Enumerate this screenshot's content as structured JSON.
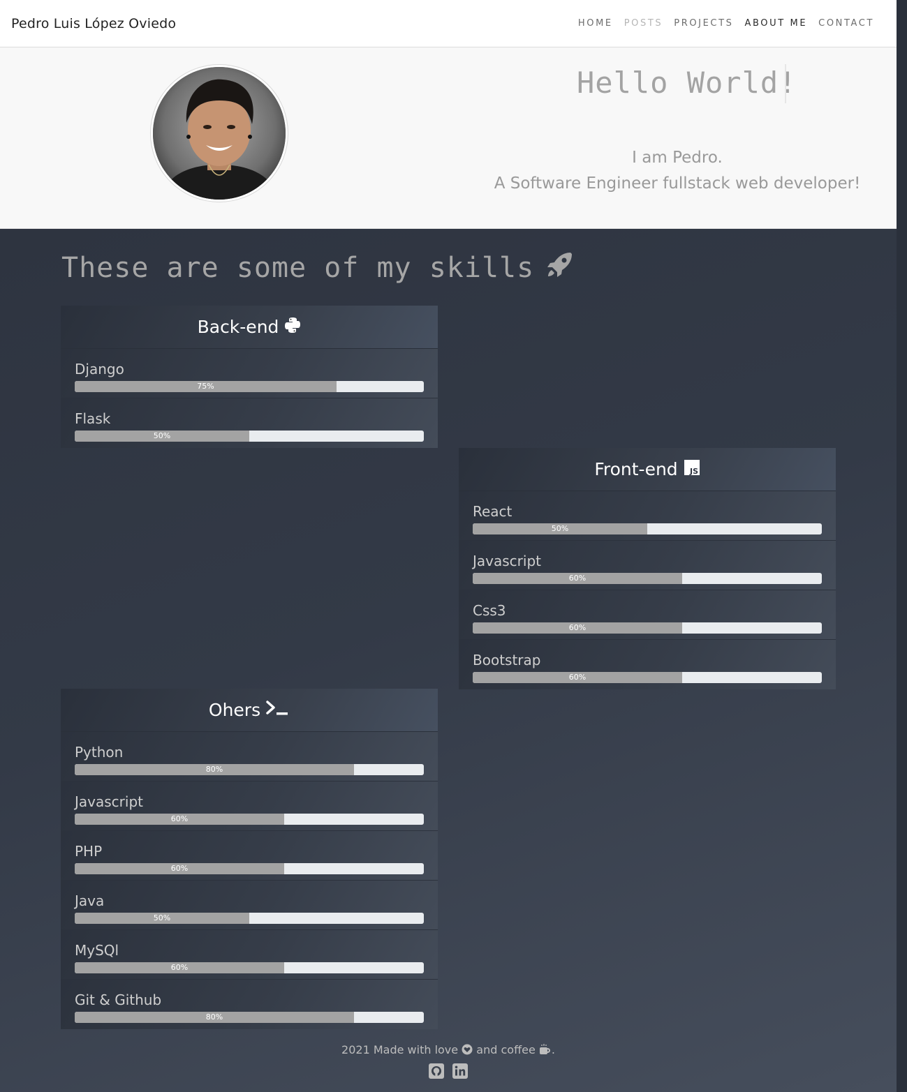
{
  "navbar": {
    "brand": "Pedro Luis López Oviedo",
    "items": [
      {
        "label": "HOME"
      },
      {
        "label": "POSTS"
      },
      {
        "label": "PROJECTS"
      },
      {
        "label": "ABOUT ME"
      },
      {
        "label": "CONTACT"
      }
    ]
  },
  "hero": {
    "title": "Hello World!",
    "line1": "I am Pedro.",
    "line2": "A Software Engineer fullstack web developer!"
  },
  "skills": {
    "title": "These are some of my skills",
    "backend": {
      "title": "Back-end",
      "items": [
        {
          "name": "Django",
          "percent": 75,
          "label": "75%"
        },
        {
          "name": "Flask",
          "percent": 50,
          "label": "50%"
        }
      ]
    },
    "frontend": {
      "title": "Front-end",
      "items": [
        {
          "name": "React",
          "percent": 50,
          "label": "50%"
        },
        {
          "name": "Javascript",
          "percent": 60,
          "label": "60%"
        },
        {
          "name": "Css3",
          "percent": 60,
          "label": "60%"
        },
        {
          "name": "Bootstrap",
          "percent": 60,
          "label": "60%"
        }
      ]
    },
    "others": {
      "title": "Ohers",
      "items": [
        {
          "name": "Python",
          "percent": 80,
          "label": "80%"
        },
        {
          "name": "Javascript",
          "percent": 60,
          "label": "60%"
        },
        {
          "name": "PHP",
          "percent": 60,
          "label": "60%"
        },
        {
          "name": "Java",
          "percent": 50,
          "label": "50%"
        },
        {
          "name": "MySQl",
          "percent": 60,
          "label": "60%"
        },
        {
          "name": "Git & Github",
          "percent": 80,
          "label": "80%"
        }
      ]
    }
  },
  "footer": {
    "text_part1": "2021 Made with love",
    "text_part2": "and coffee",
    "text_end": ".",
    "icons": [
      "github-icon",
      "linkedin-icon"
    ]
  }
}
